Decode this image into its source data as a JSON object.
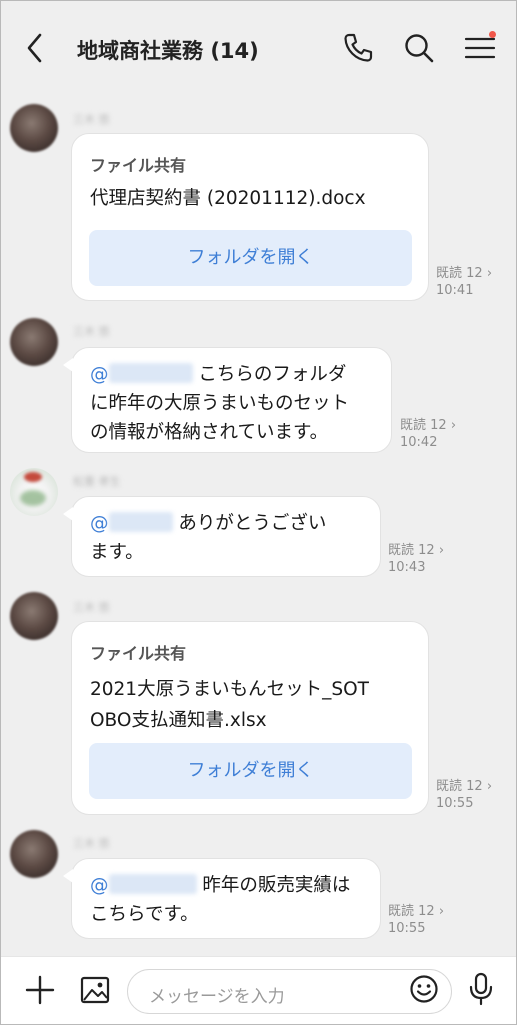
{
  "header": {
    "title": "地域商社業務",
    "count": "(14)",
    "back_icon": "chevron-left-icon",
    "call_icon": "phone-icon",
    "search_icon": "search-icon",
    "menu_icon": "hamburger-menu-icon",
    "notification_dot_color": "#f0574a"
  },
  "messages": [
    {
      "type": "file",
      "file_label": "ファイル共有",
      "file_name": "代理店契約書 (20201112).docx",
      "button_label": "フォルダを開く",
      "read_label": "既読 12",
      "time": "10:41"
    },
    {
      "type": "text",
      "mention_prefix": "@",
      "text_lines": [
        "こちらのフォルダ",
        "に昨年の大原うまいものセット",
        "の情報が格納されています。"
      ],
      "read_label": "既読 12",
      "time": "10:42"
    },
    {
      "type": "text",
      "mention_prefix": "@",
      "text_lines": [
        "ありがとうござい",
        "ます。"
      ],
      "read_label": "既読 12",
      "time": "10:43"
    },
    {
      "type": "file",
      "file_label": "ファイル共有",
      "file_name_lines": [
        "2021大原うまいもんセット_SOT",
        "OBO支払通知書.xlsx"
      ],
      "button_label": "フォルダを開く",
      "read_label": "既読 12",
      "time": "10:55"
    },
    {
      "type": "text",
      "mention_prefix": "@",
      "text_lines": [
        "昨年の販売実績は",
        "こちらです。"
      ],
      "read_label": "既読 12",
      "time": "10:55"
    }
  ],
  "composer": {
    "placeholder": "メッセージを入力",
    "plus_icon": "plus-icon",
    "image_icon": "image-icon",
    "emoji_icon": "smiley-icon",
    "mic_icon": "microphone-icon"
  },
  "colors": {
    "background": "#efefef",
    "accent": "#3f7fd6",
    "button_bg": "#e3edfb"
  }
}
